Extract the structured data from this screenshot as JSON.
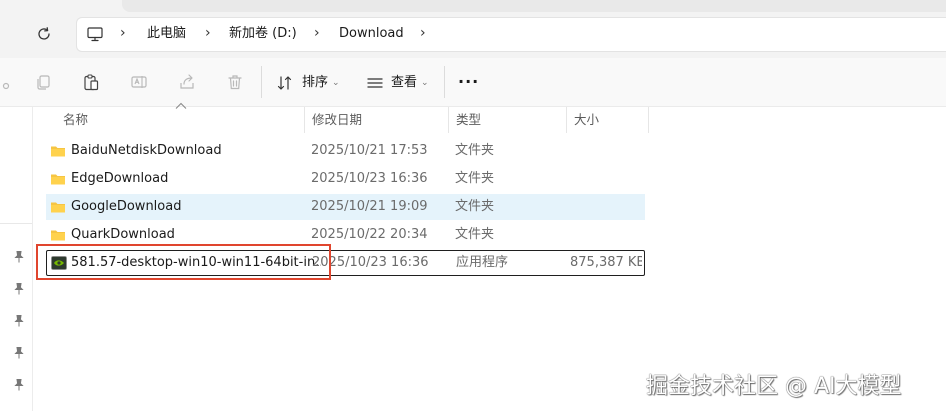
{
  "breadcrumbs": [
    "此电脑",
    "新加卷 (D:)",
    "Download"
  ],
  "toolbar": {
    "sort_label": "排序",
    "view_label": "查看",
    "more_label": "···"
  },
  "columns": {
    "name": "名称",
    "date": "修改日期",
    "type": "类型",
    "size": "大小"
  },
  "files": [
    {
      "name": "BaiduNetdiskDownload",
      "date": "2025/10/21 17:53",
      "type": "文件夹",
      "size": "",
      "icon": "folder-icon"
    },
    {
      "name": "EdgeDownload",
      "date": "2025/10/23 16:36",
      "type": "文件夹",
      "size": "",
      "icon": "folder-icon"
    },
    {
      "name": "GoogleDownload",
      "date": "2025/10/21 19:09",
      "type": "文件夹",
      "size": "",
      "icon": "folder-icon"
    },
    {
      "name": "QuarkDownload",
      "date": "2025/10/22 20:34",
      "type": "文件夹",
      "size": "",
      "icon": "folder-icon"
    },
    {
      "name": "581.57-desktop-win10-win11-64bit-in...",
      "date": "2025/10/23 16:36",
      "type": "应用程序",
      "size": "875,387 KB",
      "icon": "nvidia-installer-icon"
    }
  ],
  "watermark": "掘金技术社区 @ AI大模型",
  "colors": {
    "selected_row": "#e5f3fb",
    "annotation_box": "#e0452e",
    "folder": "#f6c543"
  }
}
